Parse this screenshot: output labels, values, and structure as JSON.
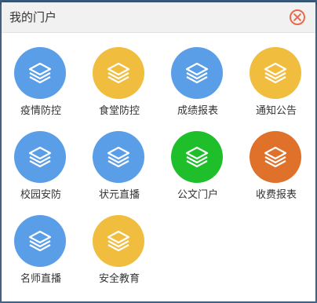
{
  "dialog": {
    "title": "我的门户",
    "close_icon": "close-circle-icon",
    "close_color": "#e8694b"
  },
  "colors": {
    "blue": "#5a9ee8",
    "yellow": "#f0bd3f",
    "green": "#1fbf2c",
    "orange": "#e0712a"
  },
  "tiles": [
    {
      "label": "疫情防控",
      "icon": "layers-icon",
      "color": "#5a9ee8"
    },
    {
      "label": "食堂防控",
      "icon": "layers-icon",
      "color": "#f0bd3f"
    },
    {
      "label": "成绩报表",
      "icon": "layers-icon",
      "color": "#5a9ee8"
    },
    {
      "label": "通知公告",
      "icon": "layers-icon",
      "color": "#f0bd3f"
    },
    {
      "label": "校园安防",
      "icon": "layers-icon",
      "color": "#5a9ee8"
    },
    {
      "label": "状元直播",
      "icon": "layers-icon",
      "color": "#5a9ee8"
    },
    {
      "label": "公文门户",
      "icon": "layers-icon",
      "color": "#1fbf2c"
    },
    {
      "label": "收费报表",
      "icon": "layers-icon",
      "color": "#e0712a"
    },
    {
      "label": "名师直播",
      "icon": "layers-icon",
      "color": "#5a9ee8"
    },
    {
      "label": "安全教育",
      "icon": "layers-icon",
      "color": "#f0bd3f"
    }
  ]
}
